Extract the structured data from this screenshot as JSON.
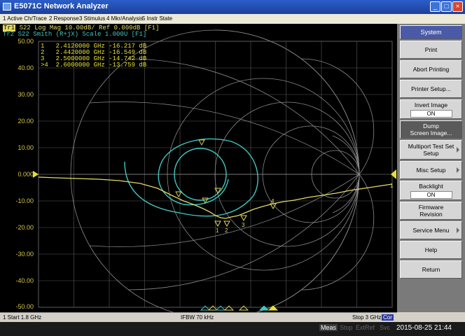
{
  "window": {
    "title": "E5071C Network Analyzer",
    "minimize_glyph": "_",
    "maximize_glyph": "□",
    "close_glyph": "×"
  },
  "menu": [
    "1 Active Ch/Trace",
    "2 Response",
    "3 Stimulus",
    "4 Mkr/Analysis",
    "5 Instr State"
  ],
  "traces": {
    "tr1_tag": "Tr1",
    "tr1": "S22 Log Mag 10.00dB/ Ref 0.000dB [F1]",
    "tr2_tag": "Tr2",
    "tr2": "S22 Smith (R+jX) Scale 1.000U [F1]"
  },
  "markers": [
    {
      "id": "1",
      "line": "1   2.4120000 GHz -16.217 dB"
    },
    {
      "id": "2",
      "line": "2   2.4420000 GHz -16.549 dB"
    },
    {
      "id": "3",
      "line": "3   2.5000000 GHz -14.742 dB"
    },
    {
      "id": "4",
      "line": ">4  2.6000000 GHz -13.759 dB"
    }
  ],
  "y_axis": {
    "ticks": [
      "50.00",
      "40.00",
      "30.00",
      "20.00",
      "10.00",
      "0.000",
      "-10.00",
      "-20.00",
      "-30.00",
      "-40.00",
      "-50.00"
    ]
  },
  "end_label": "1",
  "colors": {
    "trace1": "#e3d964",
    "trace2": "#3fc7c0",
    "grid": "#8a8a8a",
    "softkey_header": "#4a5aa6"
  },
  "softkeys": {
    "system": "System",
    "print": "Print",
    "abort_printing": "Abort Printing",
    "printer_setup": "Printer Setup...",
    "invert_image": "Invert Image",
    "invert_image_state": "ON",
    "dump_screen_1": "Dump",
    "dump_screen_2": "Screen Image...",
    "multiport_1": "Multiport Test Set",
    "multiport_2": "Setup",
    "misc_setup": "Misc Setup",
    "backlight": "Backlight",
    "backlight_state": "ON",
    "firmware_1": "Firmware",
    "firmware_2": "Revision",
    "service_menu": "Service Menu",
    "help": "Help",
    "return": "Return"
  },
  "status": {
    "start": "1  Start 1.8 GHz",
    "ifbw": "IFBW 70 kHz",
    "stop": "Stop 3 GHz",
    "cor": "Cor"
  },
  "footer": {
    "meas": "Meas",
    "stop": "Stop",
    "extref": "ExtRef",
    "svc": "Svc",
    "clock": "2015-08-25 21:44"
  }
}
